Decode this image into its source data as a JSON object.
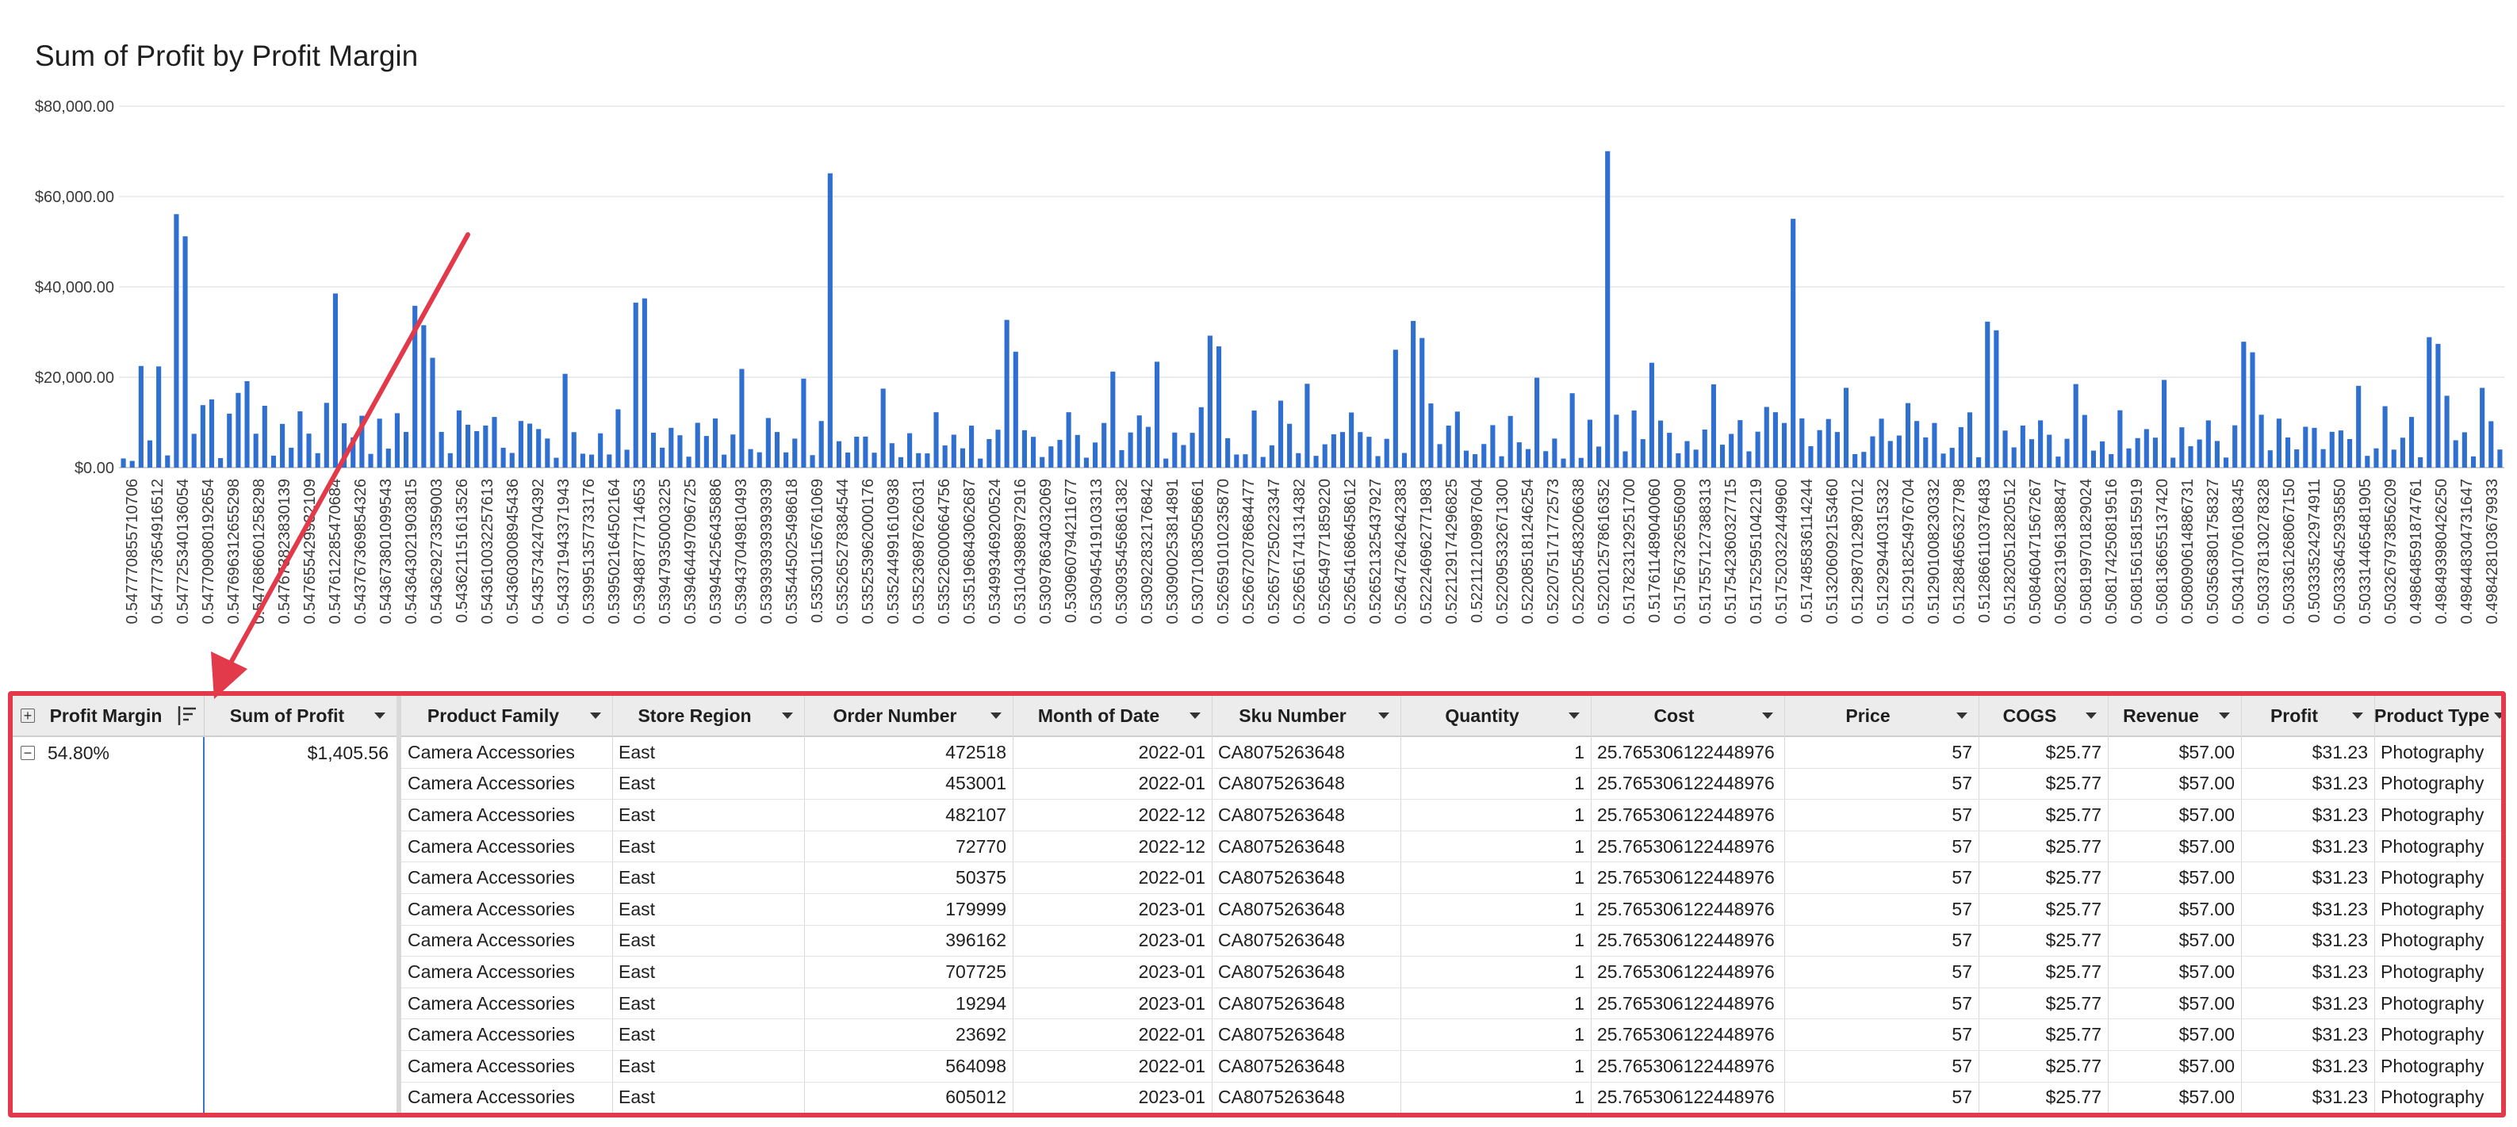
{
  "chart_title": "Sum of Profit by Profit Margin",
  "colors": {
    "bar": "#2f6fd0",
    "annotation": "#e23a4a",
    "header_bg": "#ececec"
  },
  "chart_data": {
    "type": "bar",
    "title": "Sum of Profit by Profit Margin",
    "xlabel": "",
    "ylabel": "",
    "ylim": [
      0,
      80000
    ],
    "y_ticks": [
      "$0.00",
      "$20,000.00",
      "$40,000.00",
      "$60,000.00",
      "$80,000.00"
    ],
    "grid": true,
    "x_tick_labels": [
      "0.547770855710706",
      "0.547773654916512",
      "0.547725340136054",
      "0.547709080192654",
      "0.547696312655298",
      "0.547686601258298",
      "0.547673823830139",
      "0.547655429932109",
      "0.547612285470684",
      "0.543767369854326",
      "0.543673801099543",
      "0.543643021903815",
      "0.543629273359003",
      "0.543621151613526",
      "0.543610032257613",
      "0.543603008945436",
      "0.543573424704392",
      "0.543371943371943",
      "0.539951357733176",
      "0.539502164502164",
      "0.539488777714653",
      "0.539479350003225",
      "0.539464497096725",
      "0.539454256435886",
      "0.539437049810493",
      "0.539393939393939",
      "0.535445025498618",
      "0.535301156761069",
      "0.535265278384544",
      "0.535253962000176",
      "0.535244991610938",
      "0.535236987626031",
      "0.535226000664756",
      "0.535196843062687",
      "0.534993469200524",
      "0.531043988972916",
      "0.530978634032069",
      "0.530960794211677",
      "0.530945419103313",
      "0.530935456861382",
      "0.530922832176842",
      "0.530900253814891",
      "0.530710835058661",
      "0.526591010235870",
      "0.526672078684477",
      "0.526577250223347",
      "0.526561741314382",
      "0.526549771859220",
      "0.526541686458612",
      "0.526521325437927",
      "0.526472642642383",
      "0.522246962771983",
      "0.522129174296825",
      "0.522112109987604",
      "0.522095332671300",
      "0.522085181246254",
      "0.522075171772573",
      "0.522055483206638",
      "0.522012578616352",
      "0.517823129251700",
      "0.517611489040060",
      "0.517567326556090",
      "0.517557127388313",
      "0.517542360327715",
      "0.517525951042219",
      "0.517520322449960",
      "0.517485836114244",
      "0.513206092153460",
      "0.512987012987012",
      "0.512929440315332",
      "0.512918254976704",
      "0.512901008230332",
      "0.512884656327798",
      "0.512866110376483",
      "0.512820512820512",
      "0.508460471567267",
      "0.508231961388847",
      "0.508199701829024",
      "0.508174250819516",
      "0.508156158155919",
      "0.508136655137420",
      "0.508090614886731",
      "0.503563801758327",
      "0.503410706108345",
      "0.503378130278328",
      "0.503361268067150",
      "0.503335242974911",
      "0.503336452935850",
      "0.503314465481905",
      "0.503267973856209",
      "0.498648591874761",
      "0.498493980426250",
      "0.498448304731647",
      "0.498428103679933"
    ],
    "series": [
      {
        "values": [
          2022,
          1480,
          22496,
          6030,
          22400,
          2700,
          56103,
          51200,
          7480,
          13830,
          15100,
          2100,
          11950,
          16540,
          19130,
          7500,
          13690,
          2640,
          9680,
          4400,
          12450,
          7520,
          3200,
          14330,
          38540,
          9810,
          6700,
          11480,
          3040,
          10830,
          4200,
          12040,
          7890,
          35820,
          31520,
          24310,
          7900,
          3200,
          12660,
          9500,
          8080,
          9310,
          11210,
          4390,
          3250,
          10320,
          9740,
          8530,
          6440,
          2180,
          20760,
          7850,
          3080,
          2880,
          7590,
          2910,
          12900,
          3960,
          36520,
          37450,
          7720,
          4410,
          8810,
          7160,
          2420,
          9920,
          7000,
          10870,
          2870,
          7330,
          21840,
          4090,
          3390,
          10980,
          7880,
          3370,
          6420,
          19700,
          2760,
          10310,
          65140,
          5840,
          3330,
          6840,
          6870,
          3300,
          17480,
          5400,
          2310,
          7610,
          3200,
          3150,
          12260,
          4900,
          7290,
          4270,
          9290,
          2000,
          6320,
          8390,
          32700,
          25660,
          8280,
          6810,
          2340,
          4700,
          6130,
          12260,
          7230,
          2200,
          5560,
          9880,
          21250,
          3870,
          7780,
          11550,
          9020,
          23440,
          2000,
          7760,
          5000,
          7700,
          13370,
          29210,
          26830,
          6510,
          2900,
          2950,
          12640,
          2360,
          4930,
          14820,
          9700,
          3200,
          18550,
          2600,
          5160,
          7380,
          7870,
          12200,
          7860,
          6820,
          2550,
          6370,
          26090,
          3240,
          32470,
          28690,
          14200,
          5200,
          9290,
          12400,
          3750,
          2970,
          5220,
          9400,
          2510,
          11440,
          5600,
          4100,
          19900,
          3640,
          6430,
          2000,
          16460,
          2150,
          10600,
          4660,
          70040,
          11710,
          3600,
          12650,
          6300,
          23210,
          10420,
          7700,
          3180,
          5860,
          3980,
          8420,
          18430,
          5070,
          7460,
          10510,
          3600,
          7950,
          13430,
          12260,
          9880,
          55070,
          10900,
          4740,
          8300,
          10760,
          7880,
          17660,
          2980,
          3480,
          6920,
          10830,
          5890,
          7100,
          14280,
          10310,
          6690,
          9880,
          3110,
          4380,
          8960,
          12230,
          2290,
          32310,
          30390,
          8200,
          4480,
          9310,
          6290,
          10460,
          7280,
          2440,
          6380,
          18490,
          11660,
          3760,
          5800,
          2990,
          12690,
          4250,
          6530,
          8520,
          6630,
          19410,
          2200,
          8920,
          4730,
          6220,
          10450,
          5890,
          2230,
          9360,
          27870,
          25520,
          11700,
          3830,
          10840,
          6670,
          4040,
          9040,
          8800,
          4090,
          7920,
          8230,
          6320,
          18100,
          2600,
          4260,
          13590,
          3980,
          6620,
          11210,
          2290,
          28870,
          27390,
          15900,
          6050,
          7820,
          2480,
          17650,
          10270,
          4000
        ]
      }
    ]
  },
  "table": {
    "pivot_headers": {
      "profit_margin": "Profit Margin",
      "sum_of_profit": "Sum of Profit"
    },
    "pivot_row": {
      "profit_margin": "54.80%",
      "sum_of_profit": "$1,405.56"
    },
    "columns": [
      "Product Family",
      "Store Region",
      "Order Number",
      "Month of Date",
      "Sku Number",
      "Quantity",
      "Cost",
      "Price",
      "COGS",
      "Revenue",
      "Profit",
      "Product Type"
    ],
    "rows": [
      [
        "Camera Accessories",
        "East",
        "472518",
        "2022-01",
        "CA8075263648",
        "1",
        "25.765306122448976",
        "57",
        "$25.77",
        "$57.00",
        "$31.23",
        "Photography"
      ],
      [
        "Camera Accessories",
        "East",
        "453001",
        "2022-01",
        "CA8075263648",
        "1",
        "25.765306122448976",
        "57",
        "$25.77",
        "$57.00",
        "$31.23",
        "Photography"
      ],
      [
        "Camera Accessories",
        "East",
        "482107",
        "2022-12",
        "CA8075263648",
        "1",
        "25.765306122448976",
        "57",
        "$25.77",
        "$57.00",
        "$31.23",
        "Photography"
      ],
      [
        "Camera Accessories",
        "East",
        "72770",
        "2022-12",
        "CA8075263648",
        "1",
        "25.765306122448976",
        "57",
        "$25.77",
        "$57.00",
        "$31.23",
        "Photography"
      ],
      [
        "Camera Accessories",
        "East",
        "50375",
        "2022-01",
        "CA8075263648",
        "1",
        "25.765306122448976",
        "57",
        "$25.77",
        "$57.00",
        "$31.23",
        "Photography"
      ],
      [
        "Camera Accessories",
        "East",
        "179999",
        "2023-01",
        "CA8075263648",
        "1",
        "25.765306122448976",
        "57",
        "$25.77",
        "$57.00",
        "$31.23",
        "Photography"
      ],
      [
        "Camera Accessories",
        "East",
        "396162",
        "2023-01",
        "CA8075263648",
        "1",
        "25.765306122448976",
        "57",
        "$25.77",
        "$57.00",
        "$31.23",
        "Photography"
      ],
      [
        "Camera Accessories",
        "East",
        "707725",
        "2023-01",
        "CA8075263648",
        "1",
        "25.765306122448976",
        "57",
        "$25.77",
        "$57.00",
        "$31.23",
        "Photography"
      ],
      [
        "Camera Accessories",
        "East",
        "19294",
        "2023-01",
        "CA8075263648",
        "1",
        "25.765306122448976",
        "57",
        "$25.77",
        "$57.00",
        "$31.23",
        "Photography"
      ],
      [
        "Camera Accessories",
        "East",
        "23692",
        "2022-01",
        "CA8075263648",
        "1",
        "25.765306122448976",
        "57",
        "$25.77",
        "$57.00",
        "$31.23",
        "Photography"
      ],
      [
        "Camera Accessories",
        "East",
        "564098",
        "2022-01",
        "CA8075263648",
        "1",
        "25.765306122448976",
        "57",
        "$25.77",
        "$57.00",
        "$31.23",
        "Photography"
      ],
      [
        "Camera Accessories",
        "East",
        "605012",
        "2023-01",
        "CA8075263648",
        "1",
        "25.765306122448976",
        "57",
        "$25.77",
        "$57.00",
        "$31.23",
        "Photography"
      ]
    ]
  }
}
